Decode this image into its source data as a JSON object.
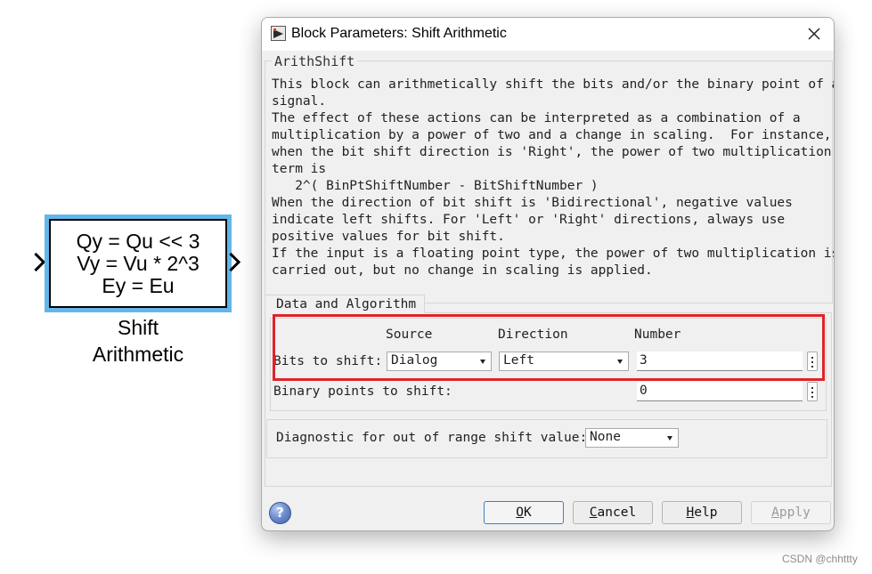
{
  "block": {
    "lines": [
      "Qy = Qu << 3",
      "Vy = Vu * 2^3",
      "Ey = Eu"
    ],
    "name_lines": [
      "Shift",
      "Arithmetic"
    ]
  },
  "dialog": {
    "title": "Block Parameters: Shift Arithmetic",
    "description_legend": "ArithShift",
    "description": "This block can arithmetically shift the bits and/or the binary point of a\nsignal.\nThe effect of these actions can be interpreted as a combination of a\nmultiplication by a power of two and a change in scaling.  For instance,\nwhen the bit shift direction is 'Right', the power of two multiplication\nterm is\n   2^( BinPtShiftNumber - BitShiftNumber )\nWhen the direction of bit shift is 'Bidirectional', negative values\nindicate left shifts. For 'Left' or 'Right' directions, always use\npositive values for bit shift.\nIf the input is a floating point type, the power of two multiplication is\ncarried out, but no change in scaling is applied.",
    "tab_label": "Data and Algorithm",
    "headers": {
      "source": "Source",
      "direction": "Direction",
      "number": "Number"
    },
    "bits_to_shift": {
      "label": "Bits to shift:",
      "source": "Dialog",
      "direction": "Left",
      "number": "3"
    },
    "binary_points": {
      "label": "Binary points to shift:",
      "value": "0"
    },
    "diagnostic": {
      "label": "Diagnostic for out of range shift value:",
      "value": "None"
    },
    "buttons": {
      "ok": {
        "mnemonic": "O",
        "rest": "K"
      },
      "cancel": {
        "mnemonic": "C",
        "rest": "ancel"
      },
      "help": {
        "mnemonic": "H",
        "rest": "elp"
      },
      "apply": {
        "mnemonic": "A",
        "rest": "pply"
      }
    },
    "help_icon_glyph": "?"
  },
  "watermark": "CSDN @chhttty",
  "colors": {
    "block_highlight": "#63b6e8",
    "annotation_red": "#e0232a",
    "ok_border": "#3c7fc4"
  }
}
